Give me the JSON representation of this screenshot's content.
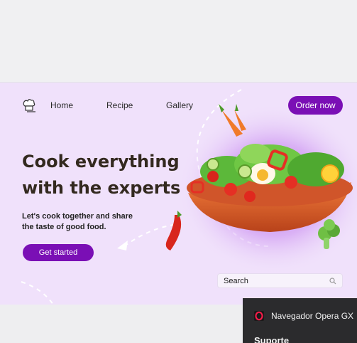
{
  "nav": {
    "links": [
      "Home",
      "Recipe",
      "Gallery"
    ],
    "order_label": "Order now"
  },
  "hero": {
    "headline_line1": "Cook everything",
    "headline_line2": "with the experts",
    "sub_line1": "Let's cook together and share",
    "sub_line2": "the taste of good food.",
    "cta_label": "Get started"
  },
  "search": {
    "placeholder": "Search"
  },
  "popup": {
    "title": "Navegador Opera GX",
    "subtitle": "Suporte"
  },
  "colors": {
    "accent": "#7a0fb5",
    "hero_bg": "#f0e1fb",
    "headline": "#33291f",
    "popup_bg": "#2b2b2d"
  },
  "icons": [
    "chef-hat-icon",
    "search-icon",
    "opera-icon"
  ]
}
